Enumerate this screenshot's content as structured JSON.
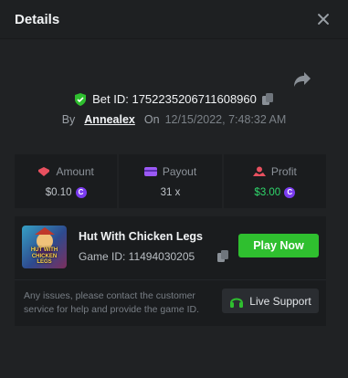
{
  "header": {
    "title": "Details"
  },
  "bet": {
    "id_label": "Bet ID: 1752235206711608960",
    "by_label": "By",
    "user": "Annealex",
    "on_label": "On",
    "date": "12/15/2022, 7:48:32 AM"
  },
  "stats": [
    {
      "label": "Amount",
      "value": "$0.10",
      "coin": "C",
      "color": "#bfc4c9",
      "icon": "amount-icon"
    },
    {
      "label": "Payout",
      "value": "31 x",
      "coin": "",
      "color": "#bfc4c9",
      "icon": "payout-icon"
    },
    {
      "label": "Profit",
      "value": "$3.00",
      "coin": "C",
      "color": "#2fd66b",
      "icon": "profit-icon"
    }
  ],
  "game": {
    "name": "Hut With Chicken Legs",
    "id_label": "Game ID: 11494030205",
    "thumb_caption": "HUT WITH CHICKEN LEGS",
    "play_label": "Play Now",
    "note": "Any issues, please contact the customer service for help and provide the game ID.",
    "support_label": "Live Support"
  },
  "colors": {
    "accent_green": "#2fbf2f",
    "profit_green": "#2fd66b",
    "coin_purple": "#7b3cf0",
    "icon_red": "#e8505f",
    "icon_purple": "#9b59f6"
  }
}
